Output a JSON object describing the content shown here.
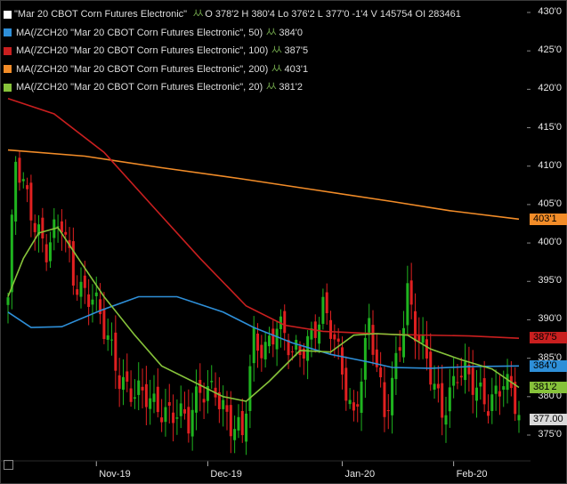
{
  "legend": {
    "main": {
      "name": "\"Mar 20 CBOT Corn Futures Electronic\"",
      "color": "#ffffff",
      "open_label": "O",
      "open": "378'2",
      "high_label": "H",
      "high": "380'4",
      "low_label": "Lo",
      "low": "376'2",
      "last_label": "L",
      "last": "377'0",
      "change": "-1'4",
      "volume_label": "V",
      "volume": "145754",
      "oi_label": "OI",
      "oi": "283461"
    },
    "studies": [
      {
        "name": "MA(/ZCH20 \"Mar 20 CBOT Corn Futures Electronic\", 50)",
        "value": "384'0",
        "color": "#2e8fd8"
      },
      {
        "name": "MA(/ZCH20 \"Mar 20 CBOT Corn Futures Electronic\", 100)",
        "value": "387'5",
        "color": "#c91f1f"
      },
      {
        "name": "MA(/ZCH20 \"Mar 20 CBOT Corn Futures Electronic\", 200)",
        "value": "403'1",
        "color": "#f28c28"
      },
      {
        "name": "MA(/ZCH20 \"Mar 20 CBOT Corn Futures Electronic\", 20)",
        "value": "381'2",
        "color": "#86c23a"
      }
    ]
  },
  "price_tags": {
    "ma200": {
      "text": "403'1",
      "value": 403.125,
      "color": "#f28c28"
    },
    "ma100": {
      "text": "387'5",
      "value": 387.625,
      "color": "#c91f1f"
    },
    "ma50": {
      "text": "384'0",
      "value": 384.0,
      "color": "#2e8fd8"
    },
    "ma20": {
      "text": "381'2",
      "value": 381.25,
      "color": "#86c23a"
    },
    "last": {
      "text": "377.00",
      "value": 377.0,
      "color": "#d9d9d9"
    }
  },
  "chart_data": {
    "type": "candlestick",
    "y_ticks": [
      "430'0",
      "425'0",
      "420'0",
      "415'0",
      "410'0",
      "405'0",
      "400'0",
      "395'0",
      "390'0",
      "385'0",
      "380'0",
      "375'0"
    ],
    "y_tick_values": [
      430,
      425,
      420,
      415,
      410,
      405,
      400,
      395,
      390,
      385,
      380,
      375
    ],
    "ylim": [
      371.5,
      431.5
    ],
    "x_ticks": [
      "Nov-19",
      "Dec-19",
      "Jan-20",
      "Feb-20"
    ],
    "x_tick_bars": [
      23,
      52,
      87,
      116
    ],
    "bar_count": 134,
    "colors": {
      "up": "#1fb31f",
      "down": "#e02020",
      "ma20": "#86c23a",
      "ma50": "#2e8fd8",
      "ma100": "#c91f1f",
      "ma200": "#f28c28"
    },
    "key_closes": [
      {
        "bar": 0,
        "close": 392
      },
      {
        "bar": 2,
        "close": 410
      },
      {
        "bar": 6,
        "close": 405
      },
      {
        "bar": 10,
        "close": 399
      },
      {
        "bar": 14,
        "close": 402
      },
      {
        "bar": 17,
        "close": 396
      },
      {
        "bar": 22,
        "close": 393
      },
      {
        "bar": 25,
        "close": 388
      },
      {
        "bar": 29,
        "close": 383
      },
      {
        "bar": 33,
        "close": 381
      },
      {
        "bar": 38,
        "close": 378
      },
      {
        "bar": 44,
        "close": 379
      },
      {
        "bar": 47,
        "close": 376
      },
      {
        "bar": 50,
        "close": 380
      },
      {
        "bar": 54,
        "close": 382
      },
      {
        "bar": 58,
        "close": 376
      },
      {
        "bar": 61,
        "close": 374
      },
      {
        "bar": 64,
        "close": 388
      },
      {
        "bar": 67,
        "close": 387
      },
      {
        "bar": 70,
        "close": 389
      },
      {
        "bar": 74,
        "close": 385
      },
      {
        "bar": 78,
        "close": 388
      },
      {
        "bar": 82,
        "close": 391
      },
      {
        "bar": 86,
        "close": 385
      },
      {
        "bar": 90,
        "close": 378
      },
      {
        "bar": 94,
        "close": 389
      },
      {
        "bar": 98,
        "close": 377
      },
      {
        "bar": 102,
        "close": 388
      },
      {
        "bar": 104,
        "close": 394
      },
      {
        "bar": 106,
        "close": 388
      },
      {
        "bar": 109,
        "close": 384
      },
      {
        "bar": 113,
        "close": 379
      },
      {
        "bar": 117,
        "close": 383
      },
      {
        "bar": 121,
        "close": 381
      },
      {
        "bar": 125,
        "close": 380
      },
      {
        "bar": 129,
        "close": 382
      },
      {
        "bar": 133,
        "close": 377
      }
    ],
    "ma_paths": {
      "ma200": [
        [
          0,
          412.1
        ],
        [
          20,
          411.3
        ],
        [
          40,
          409.8
        ],
        [
          60,
          408.4
        ],
        [
          80,
          406.9
        ],
        [
          100,
          405.4
        ],
        [
          115,
          404.2
        ],
        [
          133,
          403.1
        ]
      ],
      "ma100": [
        [
          0,
          418.8
        ],
        [
          12,
          416.8
        ],
        [
          25,
          411.8
        ],
        [
          38,
          404.6
        ],
        [
          50,
          398.0
        ],
        [
          62,
          391.8
        ],
        [
          72,
          389.3
        ],
        [
          82,
          388.5
        ],
        [
          100,
          388.1
        ],
        [
          120,
          387.9
        ],
        [
          133,
          387.6
        ]
      ],
      "ma50": [
        [
          0,
          391.0
        ],
        [
          6,
          389.0
        ],
        [
          14,
          389.1
        ],
        [
          24,
          391.2
        ],
        [
          34,
          393.0
        ],
        [
          44,
          393.0
        ],
        [
          56,
          391.0
        ],
        [
          64,
          389.0
        ],
        [
          74,
          387.0
        ],
        [
          84,
          385.5
        ],
        [
          94,
          384.5
        ],
        [
          100,
          383.8
        ],
        [
          110,
          383.7
        ],
        [
          120,
          383.9
        ],
        [
          133,
          384.0
        ]
      ],
      "ma20": [
        [
          0,
          393.0
        ],
        [
          4,
          398.0
        ],
        [
          8,
          401.3
        ],
        [
          13,
          402.0
        ],
        [
          18,
          398.2
        ],
        [
          25,
          393.0
        ],
        [
          33,
          388.0
        ],
        [
          40,
          384.0
        ],
        [
          48,
          382.0
        ],
        [
          56,
          380.0
        ],
        [
          62,
          379.4
        ],
        [
          68,
          382.0
        ],
        [
          76,
          386.0
        ],
        [
          84,
          385.8
        ],
        [
          90,
          388.0
        ],
        [
          96,
          388.2
        ],
        [
          104,
          388.0
        ],
        [
          110,
          386.2
        ],
        [
          118,
          384.8
        ],
        [
          126,
          383.6
        ],
        [
          133,
          381.2
        ]
      ]
    }
  }
}
